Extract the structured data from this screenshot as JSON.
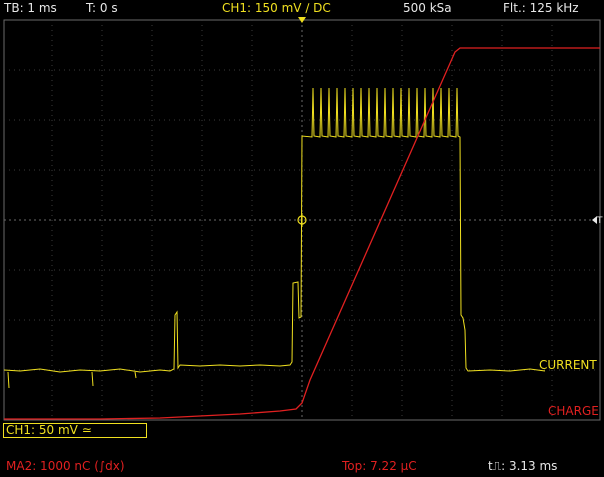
{
  "header": {
    "timebase": "TB: 1 ms",
    "trigger_time": "T: 0 s",
    "channel_setting": "CH1: 150 mV ∕ DC",
    "sample_rate": "500 kSa",
    "filter": "Flt.: 125 kHz"
  },
  "traces": {
    "current_label": "CURRENT",
    "charge_label": "CHARGE"
  },
  "channel_box": {
    "label": "CH1: 50 mV ≃"
  },
  "footer": {
    "math": "MA2: 1000 nC (∫dx)",
    "top": "Top: 7.22 µC",
    "pulse_width": "t⎍: 3.13 ms"
  },
  "colors": {
    "channel1": "#f0e020",
    "math": "#e02020",
    "grid": "#6a6a6a",
    "background": "#000000"
  }
}
